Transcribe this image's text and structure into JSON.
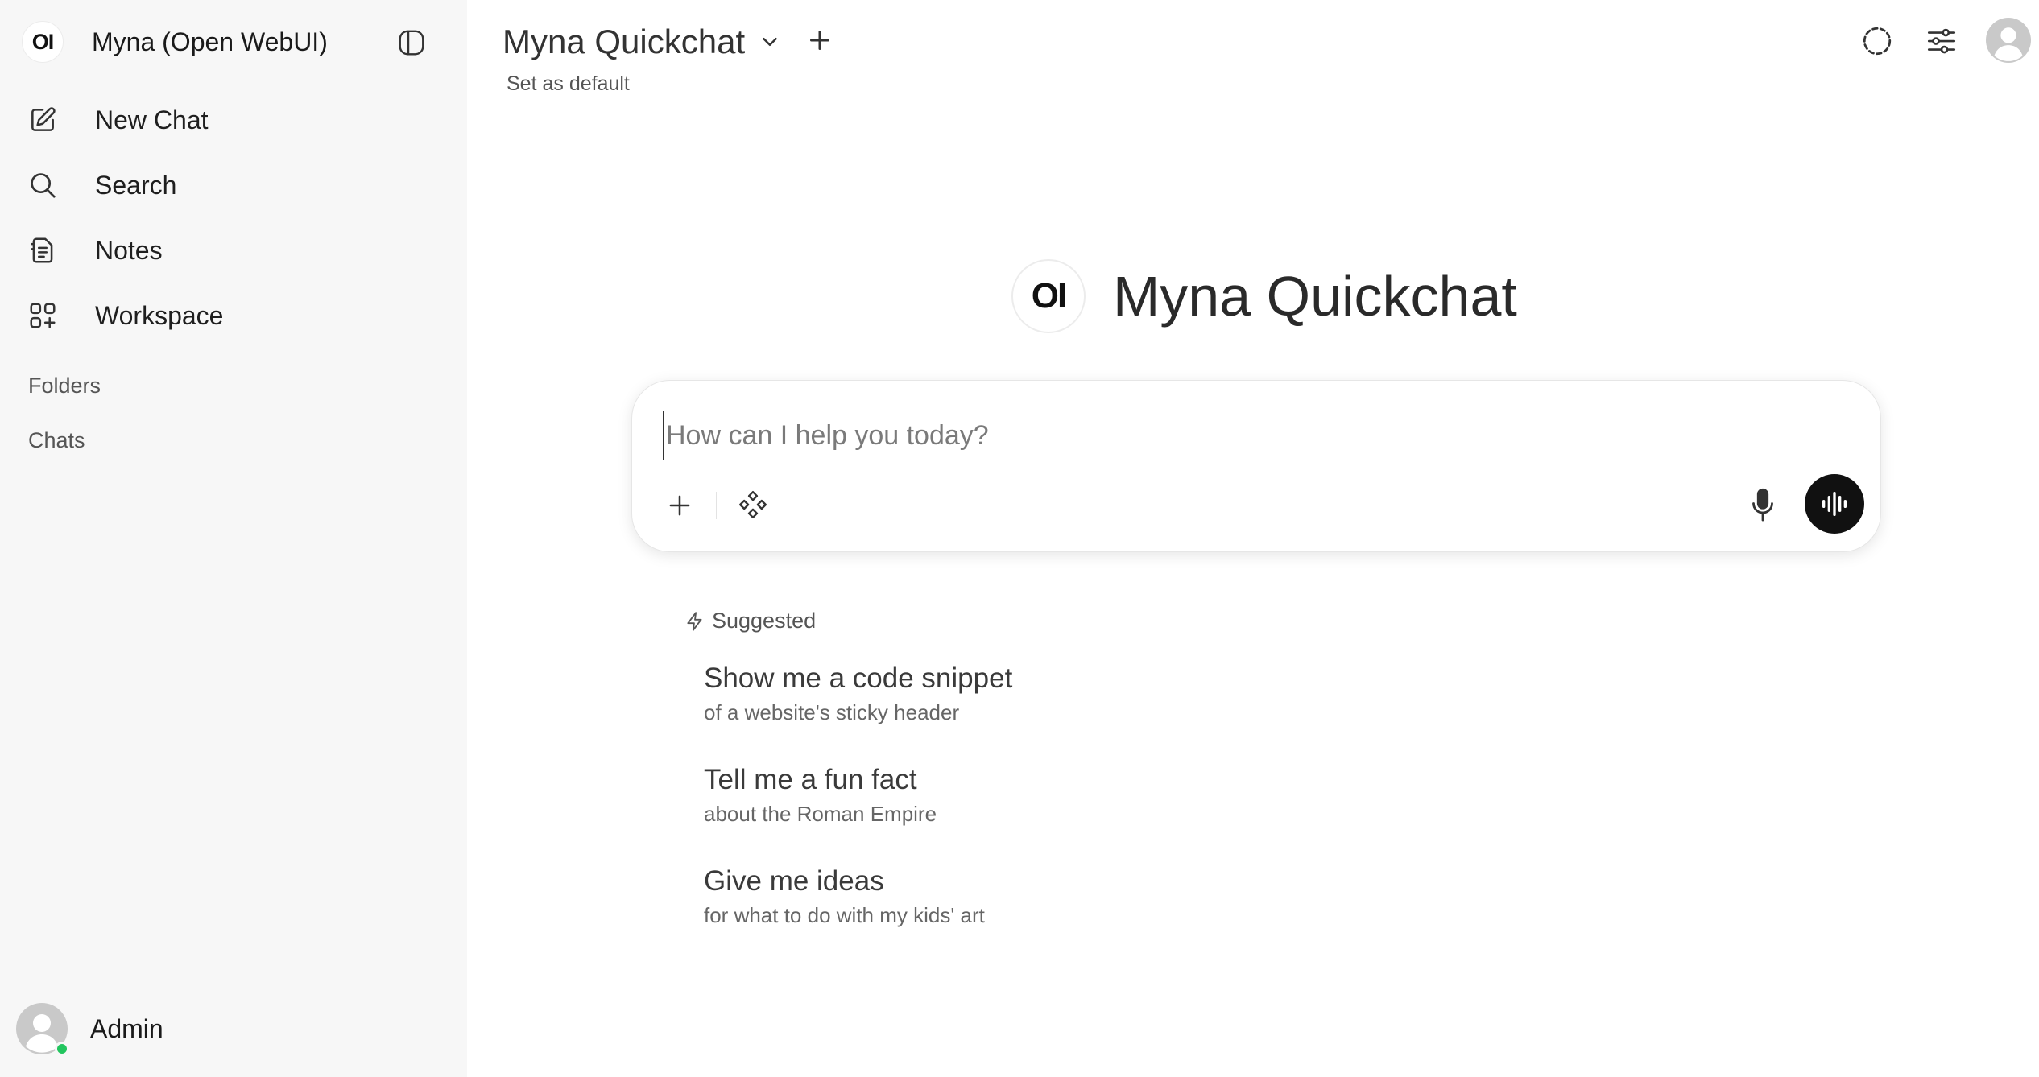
{
  "app": {
    "logo_text": "OI",
    "name": "Myna (Open WebUI)"
  },
  "sidebar": {
    "nav": [
      {
        "label": "New Chat",
        "icon": "pencil-square-icon"
      },
      {
        "label": "Search",
        "icon": "search-icon"
      },
      {
        "label": "Notes",
        "icon": "notes-icon"
      },
      {
        "label": "Workspace",
        "icon": "workspace-grid-icon"
      }
    ],
    "folders_label": "Folders",
    "chats_label": "Chats",
    "user": {
      "name": "Admin",
      "status_color": "#22c55e"
    }
  },
  "header": {
    "model_name": "Myna Quickchat",
    "set_default_label": "Set as default"
  },
  "hero": {
    "logo_text": "OI",
    "title": "Myna Quickchat"
  },
  "composer": {
    "placeholder": "How can I help you today?",
    "value": ""
  },
  "suggested": {
    "label": "Suggested",
    "items": [
      {
        "title": "Show me a code snippet",
        "subtitle": "of a website's sticky header"
      },
      {
        "title": "Tell me a fun fact",
        "subtitle": "about the Roman Empire"
      },
      {
        "title": "Give me ideas",
        "subtitle": "for what to do with my kids' art"
      }
    ]
  },
  "colors": {
    "sidebar_bg": "#f7f7f7",
    "accent_dark": "#111111",
    "online": "#22c55e"
  }
}
